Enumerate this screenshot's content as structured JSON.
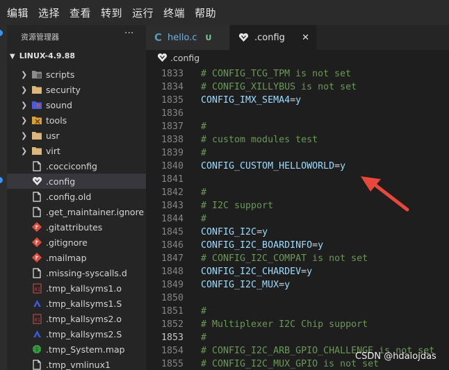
{
  "menubar": {
    "items": [
      "编辑",
      "选择",
      "查看",
      "转到",
      "运行",
      "终端",
      "帮助"
    ]
  },
  "sidebar": {
    "header": "资源管理器",
    "more": "···",
    "root": "LINUX-4.9.88",
    "items": [
      {
        "label": "scripts",
        "type": "folder",
        "icon": "scripts-folder-icon",
        "color": "#8c8c8c"
      },
      {
        "label": "security",
        "type": "folder",
        "icon": "folder-icon",
        "color": "#dcb67a"
      },
      {
        "label": "sound",
        "type": "folder",
        "icon": "sound-folder-icon",
        "color": "#4a5bd6"
      },
      {
        "label": "tools",
        "type": "folder",
        "icon": "tools-folder-icon",
        "color": "#d8a23a"
      },
      {
        "label": "usr",
        "type": "folder",
        "icon": "folder-icon",
        "color": "#dcb67a"
      },
      {
        "label": "virt",
        "type": "folder",
        "icon": "folder-icon",
        "color": "#dcb67a"
      },
      {
        "label": ".cocciconfig",
        "type": "file",
        "icon": "file-icon",
        "color": "#e6e6e6"
      },
      {
        "label": ".config",
        "type": "file",
        "icon": "heart-icon",
        "color": "#e6e6e6",
        "selected": true
      },
      {
        "label": ".config.old",
        "type": "file",
        "icon": "file-icon",
        "color": "#e6e6e6"
      },
      {
        "label": ".get_maintainer.ignore",
        "type": "file",
        "icon": "file-icon",
        "color": "#e6e6e6"
      },
      {
        "label": ".gitattributes",
        "type": "file",
        "icon": "git-icon",
        "color": "#e04b3a"
      },
      {
        "label": ".gitignore",
        "type": "file",
        "icon": "git-icon",
        "color": "#e04b3a"
      },
      {
        "label": ".mailmap",
        "type": "file",
        "icon": "git-icon",
        "color": "#e04b3a"
      },
      {
        "label": ".missing-syscalls.d",
        "type": "file",
        "icon": "file-icon",
        "color": "#e6e6e6"
      },
      {
        "label": ".tmp_kallsyms1.o",
        "type": "file",
        "icon": "binary-icon",
        "color": "#b04a4a"
      },
      {
        "label": ".tmp_kallsyms1.S",
        "type": "file",
        "icon": "assembly-icon",
        "color": "#3b5bdb"
      },
      {
        "label": ".tmp_kallsyms2.o",
        "type": "file",
        "icon": "binary-icon",
        "color": "#b04a4a"
      },
      {
        "label": ".tmp_kallsyms2.S",
        "type": "file",
        "icon": "assembly-icon",
        "color": "#3b5bdb"
      },
      {
        "label": ".tmp_System.map",
        "type": "file",
        "icon": "globe-icon",
        "color": "#3fae49"
      },
      {
        "label": ".tmp_vmlinux1",
        "type": "file",
        "icon": "file-icon",
        "color": "#e6e6e6"
      }
    ]
  },
  "tabs": [
    {
      "label": "hello.c",
      "status": "U",
      "icon": "c-file-icon"
    },
    {
      "label": ".config",
      "icon": "heart-icon",
      "close": "✕"
    }
  ],
  "breadcrumb": {
    "label": ".config"
  },
  "editor": {
    "current_line": 1853,
    "lines": [
      {
        "n": 1833,
        "text": "# CONFIG_TCG_TPM is not set",
        "kind": "comment"
      },
      {
        "n": 1834,
        "text": "# CONFIG_XILLYBUS is not set",
        "kind": "comment"
      },
      {
        "n": 1835,
        "key": "CONFIG_IMX_SEMA4",
        "val": "y",
        "kind": "setting"
      },
      {
        "n": 1836,
        "text": "",
        "kind": "blank"
      },
      {
        "n": 1837,
        "text": "#",
        "kind": "comment"
      },
      {
        "n": 1838,
        "text": "# custom modules test",
        "kind": "comment"
      },
      {
        "n": 1839,
        "text": "#",
        "kind": "comment"
      },
      {
        "n": 1840,
        "key": "CONFIG_CUSTOM_HELLOWORLD",
        "val": "y",
        "kind": "setting"
      },
      {
        "n": 1841,
        "text": "",
        "kind": "blank"
      },
      {
        "n": 1842,
        "text": "#",
        "kind": "comment"
      },
      {
        "n": 1843,
        "text": "# I2C support",
        "kind": "comment"
      },
      {
        "n": 1844,
        "text": "#",
        "kind": "comment"
      },
      {
        "n": 1845,
        "key": "CONFIG_I2C",
        "val": "y",
        "kind": "setting"
      },
      {
        "n": 1846,
        "key": "CONFIG_I2C_BOARDINFO",
        "val": "y",
        "kind": "setting"
      },
      {
        "n": 1847,
        "text": "# CONFIG_I2C_COMPAT is not set",
        "kind": "comment"
      },
      {
        "n": 1848,
        "key": "CONFIG_I2C_CHARDEV",
        "val": "y",
        "kind": "setting"
      },
      {
        "n": 1849,
        "key": "CONFIG_I2C_MUX",
        "val": "y",
        "kind": "setting"
      },
      {
        "n": 1850,
        "text": "",
        "kind": "blank"
      },
      {
        "n": 1851,
        "text": "#",
        "kind": "comment"
      },
      {
        "n": 1852,
        "text": "# Multiplexer I2C Chip support",
        "kind": "comment"
      },
      {
        "n": 1853,
        "text": "#",
        "kind": "comment"
      },
      {
        "n": 1854,
        "text": "# CONFIG_I2C_ARB_GPIO_CHALLENGE is not set",
        "kind": "comment"
      },
      {
        "n": 1855,
        "text": "# CONFIG_I2C_MUX_GPIO is not set",
        "kind": "comment"
      }
    ]
  },
  "watermark": "CSDN @hdaiojdas",
  "colors": {
    "accent": "#3794ff",
    "comment": "#6a9955",
    "setting": "#9cdcfe",
    "arrow": "#e8483a"
  }
}
